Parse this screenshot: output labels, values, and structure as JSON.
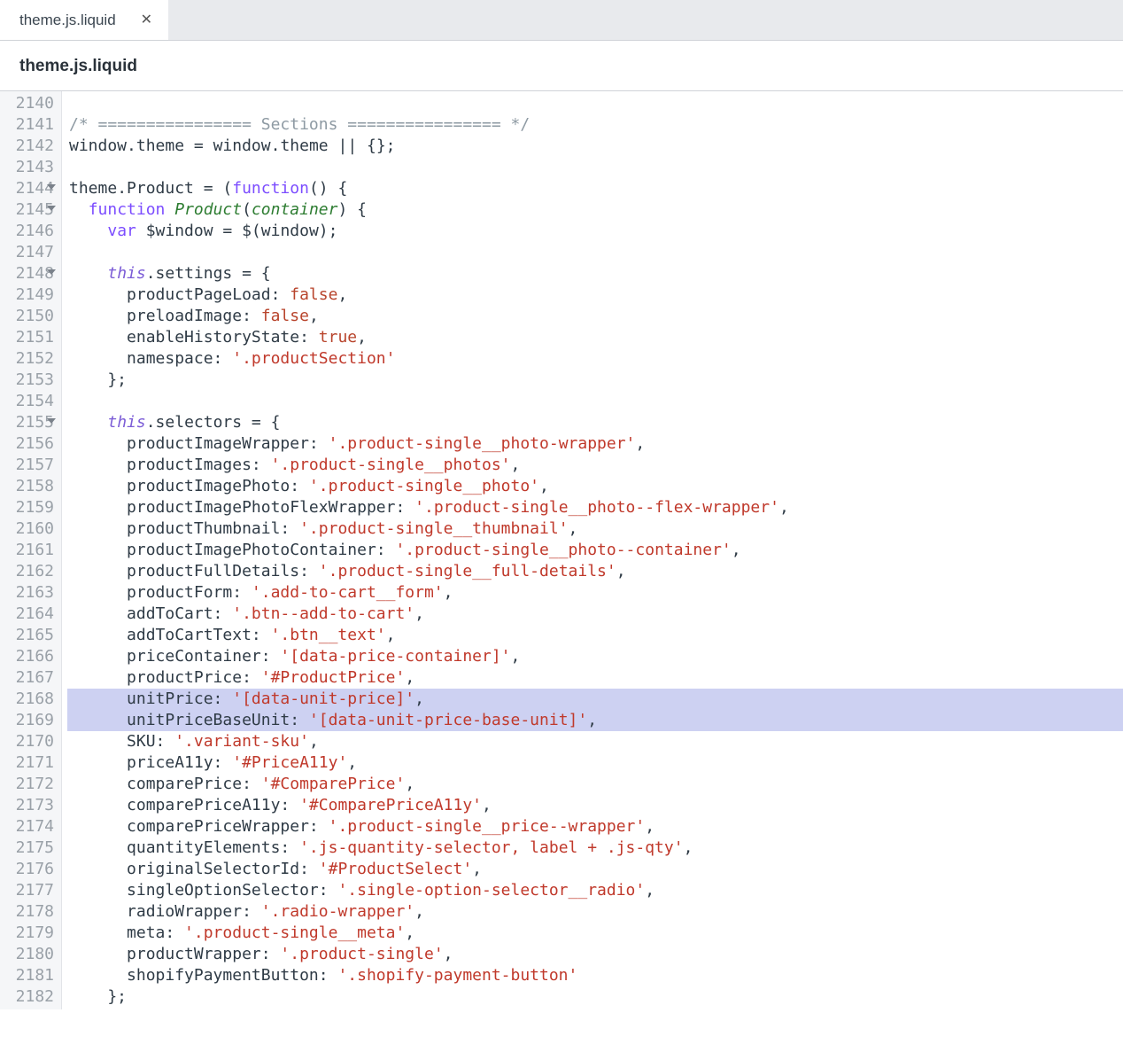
{
  "tab": {
    "label": "theme.js.liquid"
  },
  "breadcrumb": "theme.js.liquid",
  "gutter": {
    "start": 2140,
    "end": 2182,
    "foldable": [
      2144,
      2145,
      2148,
      2155
    ]
  },
  "highlighted_lines": [
    2168,
    2169
  ],
  "code": {
    "2140": [],
    "2141": [
      {
        "t": "/* ================ Sections ================ */",
        "c": "comment"
      }
    ],
    "2142": [
      {
        "t": "window",
        "c": "ident"
      },
      {
        "t": ".",
        "c": "ident"
      },
      {
        "t": "theme",
        "c": "ident"
      },
      {
        "t": " = ",
        "c": "ident"
      },
      {
        "t": "window",
        "c": "ident"
      },
      {
        "t": ".",
        "c": "ident"
      },
      {
        "t": "theme",
        "c": "ident"
      },
      {
        "t": " || {};",
        "c": "ident"
      }
    ],
    "2143": [],
    "2144": [
      {
        "t": "theme",
        "c": "ident"
      },
      {
        "t": ".",
        "c": "ident"
      },
      {
        "t": "Product",
        "c": "ident"
      },
      {
        "t": " = (",
        "c": "ident"
      },
      {
        "t": "function",
        "c": "kw"
      },
      {
        "t": "() {",
        "c": "ident"
      }
    ],
    "2145": [
      {
        "t": "  ",
        "c": "ident"
      },
      {
        "t": "function",
        "c": "kw"
      },
      {
        "t": " ",
        "c": "ident"
      },
      {
        "t": "Product",
        "c": "fn"
      },
      {
        "t": "(",
        "c": "ident"
      },
      {
        "t": "container",
        "c": "param"
      },
      {
        "t": ") {",
        "c": "ident"
      }
    ],
    "2146": [
      {
        "t": "    ",
        "c": "ident"
      },
      {
        "t": "var",
        "c": "kw"
      },
      {
        "t": " $window = $(",
        "c": "ident"
      },
      {
        "t": "window",
        "c": "ident"
      },
      {
        "t": ");",
        "c": "ident"
      }
    ],
    "2147": [],
    "2148": [
      {
        "t": "    ",
        "c": "ident"
      },
      {
        "t": "this",
        "c": "this"
      },
      {
        "t": ".settings = {",
        "c": "ident"
      }
    ],
    "2149": [
      {
        "t": "      productPageLoad: ",
        "c": "ident"
      },
      {
        "t": "false",
        "c": "bool"
      },
      {
        "t": ",",
        "c": "ident"
      }
    ],
    "2150": [
      {
        "t": "      preloadImage: ",
        "c": "ident"
      },
      {
        "t": "false",
        "c": "bool"
      },
      {
        "t": ",",
        "c": "ident"
      }
    ],
    "2151": [
      {
        "t": "      enableHistoryState: ",
        "c": "ident"
      },
      {
        "t": "true",
        "c": "bool"
      },
      {
        "t": ",",
        "c": "ident"
      }
    ],
    "2152": [
      {
        "t": "      namespace: ",
        "c": "ident"
      },
      {
        "t": "'.productSection'",
        "c": "str"
      }
    ],
    "2153": [
      {
        "t": "    };",
        "c": "ident"
      }
    ],
    "2154": [],
    "2155": [
      {
        "t": "    ",
        "c": "ident"
      },
      {
        "t": "this",
        "c": "this"
      },
      {
        "t": ".selectors = {",
        "c": "ident"
      }
    ],
    "2156": [
      {
        "t": "      productImageWrapper: ",
        "c": "ident"
      },
      {
        "t": "'.product-single__photo-wrapper'",
        "c": "str"
      },
      {
        "t": ",",
        "c": "ident"
      }
    ],
    "2157": [
      {
        "t": "      productImages: ",
        "c": "ident"
      },
      {
        "t": "'.product-single__photos'",
        "c": "str"
      },
      {
        "t": ",",
        "c": "ident"
      }
    ],
    "2158": [
      {
        "t": "      productImagePhoto: ",
        "c": "ident"
      },
      {
        "t": "'.product-single__photo'",
        "c": "str"
      },
      {
        "t": ",",
        "c": "ident"
      }
    ],
    "2159": [
      {
        "t": "      productImagePhotoFlexWrapper: ",
        "c": "ident"
      },
      {
        "t": "'.product-single__photo--flex-wrapper'",
        "c": "str"
      },
      {
        "t": ",",
        "c": "ident"
      }
    ],
    "2160": [
      {
        "t": "      productThumbnail: ",
        "c": "ident"
      },
      {
        "t": "'.product-single__thumbnail'",
        "c": "str"
      },
      {
        "t": ",",
        "c": "ident"
      }
    ],
    "2161": [
      {
        "t": "      productImagePhotoContainer: ",
        "c": "ident"
      },
      {
        "t": "'.product-single__photo--container'",
        "c": "str"
      },
      {
        "t": ",",
        "c": "ident"
      }
    ],
    "2162": [
      {
        "t": "      productFullDetails: ",
        "c": "ident"
      },
      {
        "t": "'.product-single__full-details'",
        "c": "str"
      },
      {
        "t": ",",
        "c": "ident"
      }
    ],
    "2163": [
      {
        "t": "      productForm: ",
        "c": "ident"
      },
      {
        "t": "'.add-to-cart__form'",
        "c": "str"
      },
      {
        "t": ",",
        "c": "ident"
      }
    ],
    "2164": [
      {
        "t": "      addToCart: ",
        "c": "ident"
      },
      {
        "t": "'.btn--add-to-cart'",
        "c": "str"
      },
      {
        "t": ",",
        "c": "ident"
      }
    ],
    "2165": [
      {
        "t": "      addToCartText: ",
        "c": "ident"
      },
      {
        "t": "'.btn__text'",
        "c": "str"
      },
      {
        "t": ",",
        "c": "ident"
      }
    ],
    "2166": [
      {
        "t": "      priceContainer: ",
        "c": "ident"
      },
      {
        "t": "'[data-price-container]'",
        "c": "str"
      },
      {
        "t": ",",
        "c": "ident"
      }
    ],
    "2167": [
      {
        "t": "      productPrice: ",
        "c": "ident"
      },
      {
        "t": "'#ProductPrice'",
        "c": "str"
      },
      {
        "t": ",",
        "c": "ident"
      }
    ],
    "2168": [
      {
        "t": "      unitPrice: ",
        "c": "ident"
      },
      {
        "t": "'[data-unit-price]'",
        "c": "str"
      },
      {
        "t": ",",
        "c": "ident"
      }
    ],
    "2169": [
      {
        "t": "      unitPriceBaseUnit: ",
        "c": "ident"
      },
      {
        "t": "'[data-unit-price-base-unit]'",
        "c": "str"
      },
      {
        "t": ",",
        "c": "ident"
      }
    ],
    "2170": [
      {
        "t": "      SKU: ",
        "c": "ident"
      },
      {
        "t": "'.variant-sku'",
        "c": "str"
      },
      {
        "t": ",",
        "c": "ident"
      }
    ],
    "2171": [
      {
        "t": "      priceA11y: ",
        "c": "ident"
      },
      {
        "t": "'#PriceA11y'",
        "c": "str"
      },
      {
        "t": ",",
        "c": "ident"
      }
    ],
    "2172": [
      {
        "t": "      comparePrice: ",
        "c": "ident"
      },
      {
        "t": "'#ComparePrice'",
        "c": "str"
      },
      {
        "t": ",",
        "c": "ident"
      }
    ],
    "2173": [
      {
        "t": "      comparePriceA11y: ",
        "c": "ident"
      },
      {
        "t": "'#ComparePriceA11y'",
        "c": "str"
      },
      {
        "t": ",",
        "c": "ident"
      }
    ],
    "2174": [
      {
        "t": "      comparePriceWrapper: ",
        "c": "ident"
      },
      {
        "t": "'.product-single__price--wrapper'",
        "c": "str"
      },
      {
        "t": ",",
        "c": "ident"
      }
    ],
    "2175": [
      {
        "t": "      quantityElements: ",
        "c": "ident"
      },
      {
        "t": "'.js-quantity-selector, label + .js-qty'",
        "c": "str"
      },
      {
        "t": ",",
        "c": "ident"
      }
    ],
    "2176": [
      {
        "t": "      originalSelectorId: ",
        "c": "ident"
      },
      {
        "t": "'#ProductSelect'",
        "c": "str"
      },
      {
        "t": ",",
        "c": "ident"
      }
    ],
    "2177": [
      {
        "t": "      singleOptionSelector: ",
        "c": "ident"
      },
      {
        "t": "'.single-option-selector__radio'",
        "c": "str"
      },
      {
        "t": ",",
        "c": "ident"
      }
    ],
    "2178": [
      {
        "t": "      radioWrapper: ",
        "c": "ident"
      },
      {
        "t": "'.radio-wrapper'",
        "c": "str"
      },
      {
        "t": ",",
        "c": "ident"
      }
    ],
    "2179": [
      {
        "t": "      meta: ",
        "c": "ident"
      },
      {
        "t": "'.product-single__meta'",
        "c": "str"
      },
      {
        "t": ",",
        "c": "ident"
      }
    ],
    "2180": [
      {
        "t": "      productWrapper: ",
        "c": "ident"
      },
      {
        "t": "'.product-single'",
        "c": "str"
      },
      {
        "t": ",",
        "c": "ident"
      }
    ],
    "2181": [
      {
        "t": "      shopifyPaymentButton: ",
        "c": "ident"
      },
      {
        "t": "'.shopify-payment-button'",
        "c": "str"
      }
    ],
    "2182": [
      {
        "t": "    };",
        "c": "ident"
      }
    ]
  }
}
